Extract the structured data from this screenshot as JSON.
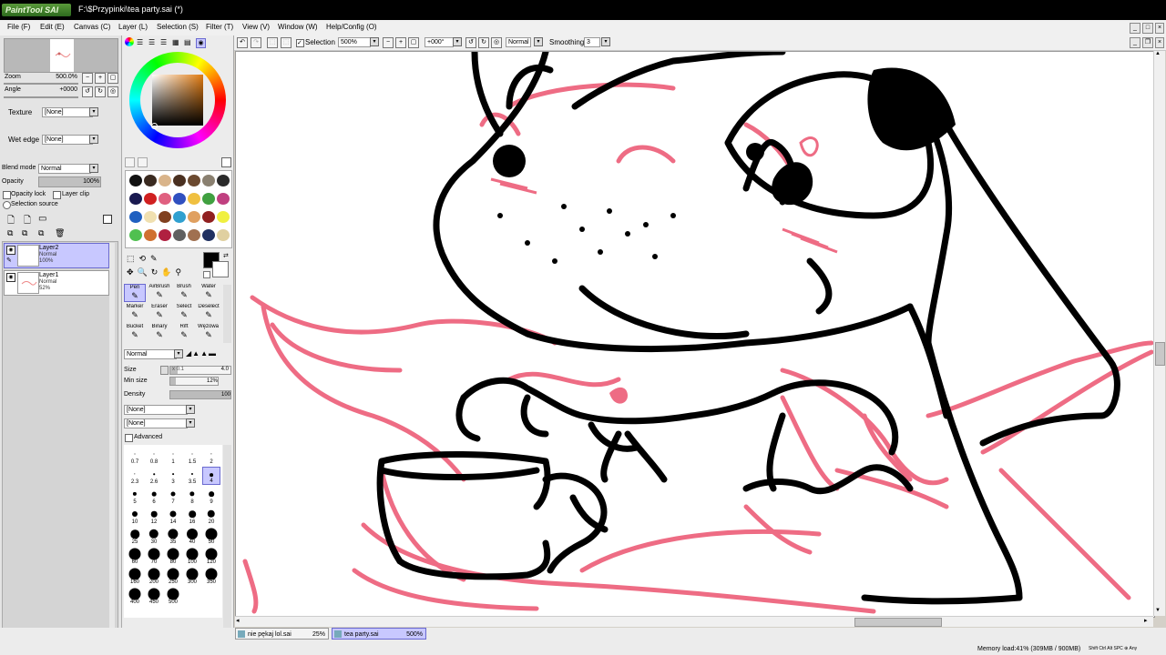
{
  "app": {
    "logo_text": "PaintTool SAI",
    "window_title": "F:\\$Przypinki\\tea party.sai (*)"
  },
  "menu": [
    "File (F)",
    "Edit (E)",
    "Canvas (C)",
    "Layer (L)",
    "Selection (S)",
    "Filter (T)",
    "View (V)",
    "Window (W)",
    "Help/Config (O)"
  ],
  "navigator": {
    "zoom_label": "Zoom",
    "zoom_value": "500.0%",
    "angle_label": "Angle",
    "angle_value": "+0000"
  },
  "layer_props": {
    "texture_label": "Texture",
    "texture_value": "[None]",
    "wet_edge_label": "Wet edge",
    "wet_edge_value": "[None]",
    "blend_mode_label": "Blend mode",
    "blend_mode_value": "Normal",
    "opacity_label": "Opacity",
    "opacity_value": "100%",
    "opacity_lock_label": "Opacity lock",
    "layer_clip_label": "Layer clip",
    "selection_source_label": "Selection source"
  },
  "layers": [
    {
      "name": "Layer2",
      "mode": "Normal",
      "opacity": "100%",
      "selected": true
    },
    {
      "name": "Layer1",
      "mode": "Normal",
      "opacity": "52%",
      "selected": false
    }
  ],
  "swatches": [
    "#111111",
    "#3a2a20",
    "#d9b48a",
    "#4a3020",
    "#6b4a30",
    "#8a8070",
    "#2a2a2a",
    "#1a1a50",
    "#d02020",
    "#e06080",
    "#3050c0",
    "#f0c040",
    "#40a040",
    "#c04080",
    "#2060c0",
    "#f0e0b0",
    "#804020",
    "#30a0d0",
    "#e0a060",
    "#902020",
    "#f0f040",
    "#50c050",
    "#d07030",
    "#b02040",
    "#606060",
    "#a07050",
    "#203060",
    "#e0d0a0"
  ],
  "tools": {
    "names": [
      "Pen",
      "AirBrush",
      "Brush",
      "Water",
      "Marker",
      "Eraser",
      "Select",
      "Deselect",
      "Bucket",
      "Binary",
      "Rift",
      "Wężowa Nożyc"
    ],
    "selected": "Pen"
  },
  "brush_settings": {
    "mode_value": "Normal",
    "size_label": "Size",
    "size_mult": "x 0.1",
    "size_value": "4.0",
    "min_size_label": "Min size",
    "min_size_value": "12%",
    "density_label": "Density",
    "density_value": "100",
    "shape_value": "[None]",
    "texture_value": "[None]",
    "advanced_label": "Advanced"
  },
  "brush_sizes": [
    "0.7",
    "0.8",
    "1",
    "1.5",
    "2",
    "2.3",
    "2.6",
    "3",
    "3.5",
    "4",
    "5",
    "6",
    "7",
    "8",
    "9",
    "10",
    "12",
    "14",
    "16",
    "20",
    "25",
    "30",
    "35",
    "40",
    "50",
    "60",
    "70",
    "80",
    "100",
    "120",
    "160",
    "200",
    "250",
    "300",
    "350",
    "400",
    "450",
    "500"
  ],
  "brush_sizes_selected": "4",
  "canvas_toolbar": {
    "selection_label": "Selection",
    "zoom_value": "500%",
    "angle_value": "+000°",
    "mode_value": "Normal",
    "smoothing_label": "Smoothing",
    "smoothing_value": "3"
  },
  "doc_tabs": [
    {
      "name": "nie pękaj lol.sai",
      "zoom": "25%",
      "active": false
    },
    {
      "name": "tea party.sai",
      "zoom": "500%",
      "active": true
    }
  ],
  "status": {
    "memory": "Memory load:41% (309MB / 900MB)",
    "keys": "Shift Ctrl Alt SPC ⊕ Any"
  },
  "colors": {
    "accent": "#c8c8ff",
    "sketch_pink": "#ee6c84",
    "ink": "#000000"
  }
}
